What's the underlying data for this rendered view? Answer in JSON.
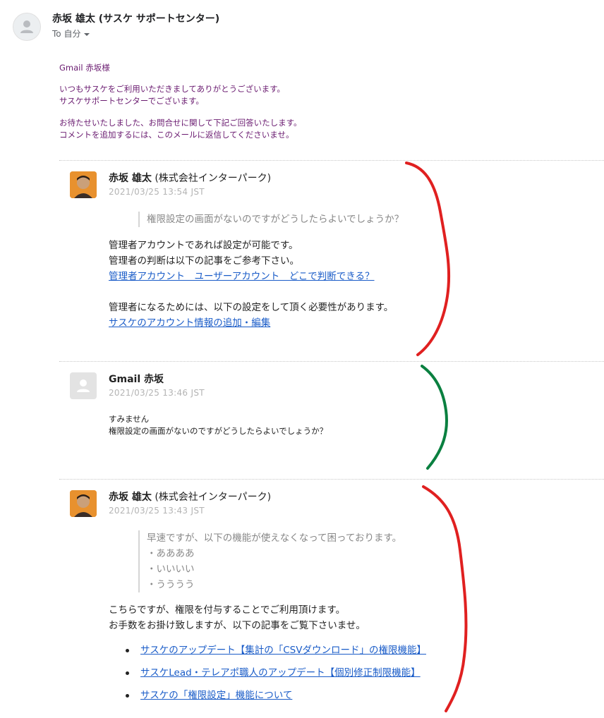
{
  "header": {
    "sender": "赤坂 雄太 (サスケ サポートセンター)",
    "to_label": "To 自分"
  },
  "intro": {
    "greeting": "Gmail 赤坂様",
    "line1": "いつもサスケをご利用いただきましてありがとうございます。",
    "line2": "サスケサポートセンターでございます。",
    "line3": "お待たせいたしました、お問合せに関して下記ご回答いたします。",
    "line4": "コメントを追加するには、このメールに返信してくださいませ。"
  },
  "comments": [
    {
      "name": "赤坂 雄太",
      "org": "(株式会社インターパーク)",
      "time": "2021/03/25 13:54 JST",
      "quote": [
        "権限設定の画面がないのですがどうしたらよいでしょうか？"
      ],
      "lines": [
        "管理者アカウントであれば設定が可能です。",
        "管理者の判断は以下の記事をご参考下さい。"
      ],
      "link1": "管理者アカウント　ユーザーアカウント　どこで判断できる？",
      "line3": "管理者になるためには、以下の設定をして頂く必要性があります。",
      "link2": "サスケのアカウント情報の追加・編集"
    },
    {
      "name": "Gmail 赤坂",
      "time": "2021/03/25 13:46 JST",
      "lines": [
        "すみません",
        "権限設定の画面がないのですがどうしたらよいでしょうか？"
      ]
    },
    {
      "name": "赤坂 雄太",
      "org": "(株式会社インターパーク)",
      "time": "2021/03/25 13:43 JST",
      "quote": [
        "早速ですが、以下の機能が使えなくなって困っております。",
        "・ああああ",
        "・いいいい",
        "・うううう"
      ],
      "lines": [
        "こちらですが、権限を付与することでご利用頂けます。",
        "お手数をお掛け致しますが、以下の記事をご覧下さいませ。"
      ],
      "links": [
        "サスケのアップデート【集計の「CSVダウンロード」の権限機能】",
        "サスケLead・テレアポ職人のアップデート【個別修正制限機能】",
        "サスケの「権限設定」機能について"
      ]
    }
  ],
  "colors": {
    "intro_text": "#6a1b70",
    "link": "#1a5cc8",
    "annotation_red": "#e02020",
    "annotation_green": "#0a8040"
  }
}
